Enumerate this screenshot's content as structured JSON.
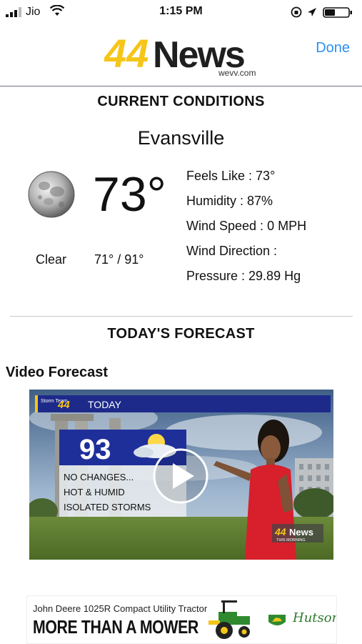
{
  "status_bar": {
    "carrier": "Jio",
    "time": "1:15 PM"
  },
  "header": {
    "logo_number": "44",
    "logo_word": "News",
    "logo_sub": "wevv.com",
    "done_label": "Done"
  },
  "current": {
    "title": "CURRENT CONDITIONS",
    "city": "Evansville",
    "temperature": "73°",
    "condition": "Clear",
    "hi_lo": "71° / 91°",
    "details": [
      {
        "label": "Feels Like :",
        "value": "73°"
      },
      {
        "label": "Humidity :",
        "value": "87%"
      },
      {
        "label": "Wind Speed :",
        "value": "0 MPH"
      },
      {
        "label": "Wind Direction :",
        "value": ""
      },
      {
        "label": "Pressure :",
        "value": "29.89 Hg"
      }
    ]
  },
  "forecast": {
    "title": "TODAY'S FORECAST",
    "video_label": "Video Forecast",
    "video": {
      "brand": "Storm Team",
      "brand_number": "44",
      "today_label": "TODAY",
      "high": "93",
      "lines": [
        "NO CHANGES...",
        "HOT & HUMID",
        "ISOLATED STORMS"
      ],
      "bug_number": "44",
      "bug_word": "News",
      "bug_sub": "THIS MORNING"
    }
  },
  "ad": {
    "top_line": "John Deere 1025R Compact Utility Tractor",
    "headline": "MORE THAN A MOWER",
    "dealer": "Hutson"
  },
  "colors": {
    "accent_blue": "#2c8ff0",
    "logo_yellow": "#f5c518",
    "graphic_blue": "#1d2a8a"
  }
}
